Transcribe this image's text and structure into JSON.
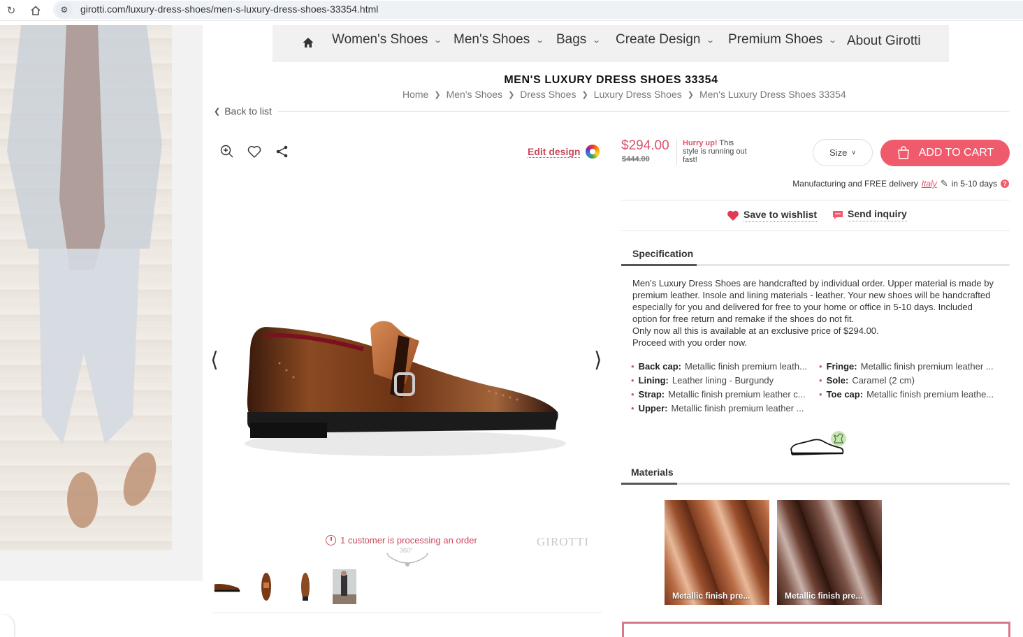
{
  "browser": {
    "url": "girotti.com/luxury-dress-shoes/men-s-luxury-dress-shoes-33354.html"
  },
  "nav": {
    "items": [
      {
        "label": "Women's Shoes",
        "dropdown": true
      },
      {
        "label": "Men's Shoes",
        "dropdown": true
      },
      {
        "label": "Bags",
        "dropdown": true
      },
      {
        "label": "Create Design",
        "dropdown": true
      },
      {
        "label": "Premium Shoes",
        "dropdown": true
      },
      {
        "label": "About Girotti",
        "dropdown": false
      }
    ]
  },
  "product": {
    "title": "MEN'S LUXURY DRESS SHOES 33354",
    "breadcrumbs": [
      "Home",
      "Men's Shoes",
      "Dress Shoes",
      "Luxury Dress Shoes",
      "Men's Luxury Dress Shoes 33354"
    ],
    "back_label": "Back to list",
    "edit_design_label": "Edit design",
    "processing_text": "1 customer is processing an order",
    "watermark": "GIROTTI",
    "rotate_label": "360°",
    "price": "$294.00",
    "old_price": "$444.00",
    "hurry_bold": "Hurry up!",
    "hurry_text": " This style is running out fast!",
    "size_label": "Size",
    "add_to_cart_label": "ADD TO CART",
    "delivery_prefix": "Manufacturing and FREE delivery",
    "delivery_country": "Italy",
    "delivery_time": "in 5-10 days",
    "help_icon_text": "?",
    "save_wishlist_label": "Save to wishlist",
    "send_inquiry_label": "Send inquiry"
  },
  "specification": {
    "tab_label": "Specification",
    "description": [
      "Men's Luxury Dress Shoes are handcrafted by individual order. Upper material is made by premium leather. Insole and lining materials - leather. Your new shoes will be handcrafted especially for you and delivered for free to your home or office in 5-10 days. Included option for free return and remake if the shoes do not fit.",
      "Only now all this is available at an exclusive price of $294.00.",
      "Proceed with you order now."
    ],
    "specs": [
      {
        "key": "Back cap:",
        "value": "Metallic finish premium leath..."
      },
      {
        "key": "Fringe:",
        "value": "Metallic finish premium leather ..."
      },
      {
        "key": "Lining:",
        "value": "Leather lining - Burgundy"
      },
      {
        "key": "Sole:",
        "value": "Caramel (2 cm)"
      },
      {
        "key": "Strap:",
        "value": "Metallic finish premium leather c..."
      },
      {
        "key": "Toe cap:",
        "value": "Metallic finish premium leathe..."
      },
      {
        "key": "Upper:",
        "value": "Metallic finish premium leather ..."
      }
    ]
  },
  "materials": {
    "tab_label": "Materials",
    "items": [
      {
        "label": "Metallic finish pre..."
      },
      {
        "label": "Metallic finish pre..."
      }
    ]
  },
  "colors": {
    "accent": "#ef5b6c",
    "price": "#d9536a",
    "nav_bg": "#f1f1f1"
  }
}
